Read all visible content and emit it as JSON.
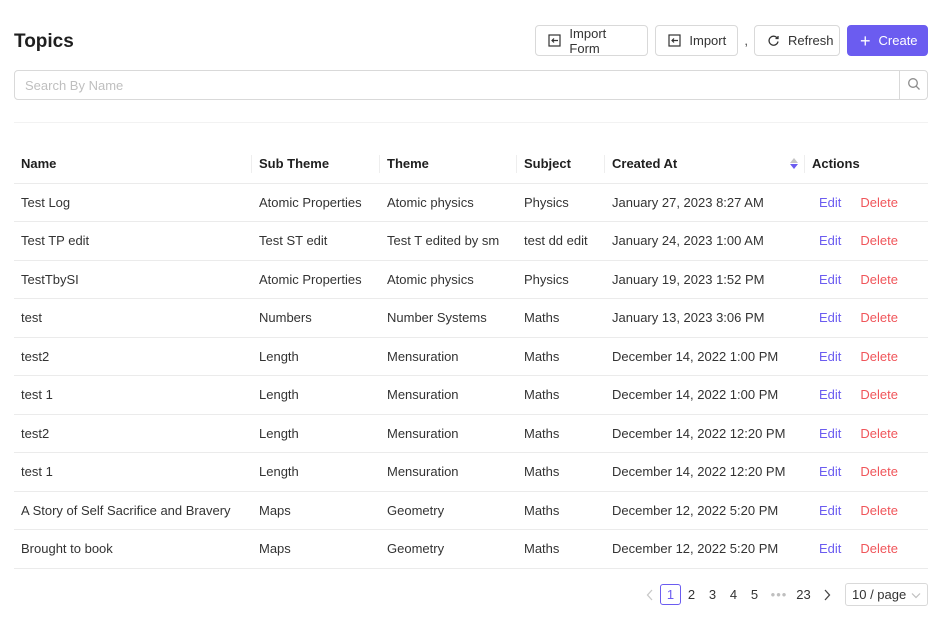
{
  "page": {
    "title": "Topics"
  },
  "toolbar": {
    "import_form_label": "Import Form",
    "import_label": "Import",
    "separator": ",",
    "refresh_label": "Refresh",
    "create_label": "Create"
  },
  "search": {
    "placeholder": "Search By Name",
    "value": ""
  },
  "table": {
    "columns": [
      "Name",
      "Sub Theme",
      "Theme",
      "Subject",
      "Created At",
      "Actions"
    ],
    "sorted_column": "Created At",
    "sort_direction": "descending",
    "rows": [
      {
        "name": "Test Log",
        "sub_theme": "Atomic Properties",
        "theme": "Atomic physics",
        "subject": "Physics",
        "created_at": "January 27, 2023 8:27 AM",
        "edit": "Edit",
        "delete": "Delete"
      },
      {
        "name": "Test TP edit",
        "sub_theme": "Test ST edit",
        "theme": "Test T edited by sm",
        "subject": "test dd edit",
        "created_at": "January 24, 2023 1:00 AM",
        "edit": "Edit",
        "delete": "Delete"
      },
      {
        "name": "TestTbySI",
        "sub_theme": "Atomic Properties",
        "theme": "Atomic physics",
        "subject": "Physics",
        "created_at": "January 19, 2023 1:52 PM",
        "edit": "Edit",
        "delete": "Delete"
      },
      {
        "name": "test",
        "sub_theme": "Numbers",
        "theme": "Number Systems",
        "subject": "Maths",
        "created_at": "January 13, 2023 3:06 PM",
        "edit": "Edit",
        "delete": "Delete"
      },
      {
        "name": "test2",
        "sub_theme": "Length",
        "theme": "Mensuration",
        "subject": "Maths",
        "created_at": "December 14, 2022 1:00 PM",
        "edit": "Edit",
        "delete": "Delete"
      },
      {
        "name": "test 1",
        "sub_theme": "Length",
        "theme": "Mensuration",
        "subject": "Maths",
        "created_at": "December 14, 2022 1:00 PM",
        "edit": "Edit",
        "delete": "Delete"
      },
      {
        "name": "test2",
        "sub_theme": "Length",
        "theme": "Mensuration",
        "subject": "Maths",
        "created_at": "December 14, 2022 12:20 PM",
        "edit": "Edit",
        "delete": "Delete"
      },
      {
        "name": "test 1",
        "sub_theme": "Length",
        "theme": "Mensuration",
        "subject": "Maths",
        "created_at": "December 14, 2022 12:20 PM",
        "edit": "Edit",
        "delete": "Delete"
      },
      {
        "name": "A Story of Self Sacrifice and Bravery",
        "sub_theme": "Maps",
        "theme": "Geometry",
        "subject": "Maths",
        "created_at": "December 12, 2022 5:20 PM",
        "edit": "Edit",
        "delete": "Delete"
      },
      {
        "name": "Brought to book",
        "sub_theme": "Maps",
        "theme": "Geometry",
        "subject": "Maths",
        "created_at": "December 12, 2022 5:20 PM",
        "edit": "Edit",
        "delete": "Delete"
      }
    ]
  },
  "pagination": {
    "prev_icon": "chevron-left-icon",
    "pages": [
      "1",
      "2",
      "3",
      "4",
      "5"
    ],
    "current_page": "1",
    "ellipsis": "•••",
    "last_page": "23",
    "next_icon": "chevron-right-icon",
    "page_size": "10 / page"
  },
  "colors": {
    "accent": "#6b5cf0",
    "danger": "#f0555a",
    "border": "#d9d9d9"
  }
}
